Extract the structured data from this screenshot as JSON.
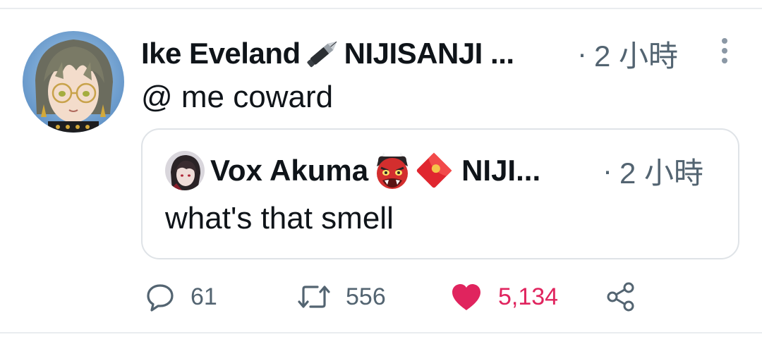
{
  "tweet": {
    "author": "Ike Eveland",
    "author_suffix": "NIJISANJI ...",
    "time_separator": "·",
    "time": "2 小時",
    "text": "@ me coward"
  },
  "quote": {
    "author": "Vox Akuma",
    "author_suffix": "NIJI...",
    "time_separator": "·",
    "time": "2 小時",
    "text": "what's that smell"
  },
  "actions": {
    "reply_count": "61",
    "retweet_count": "556",
    "like_count": "5,134"
  },
  "colors": {
    "like_active": "#e0245e",
    "secondary_text": "#536471",
    "divider": "#e9ecef"
  },
  "icons": {
    "reply": "speech-bubble-icon",
    "retweet": "retweet-arrows-icon",
    "like": "heart-icon",
    "share": "share-nodes-icon",
    "more": "vertical-ellipsis-icon"
  }
}
